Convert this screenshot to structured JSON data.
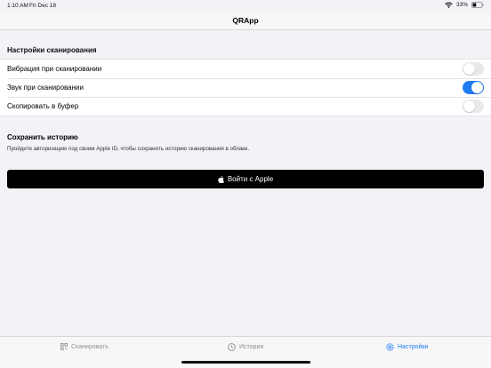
{
  "status_bar": {
    "time": "1:10 AM",
    "date": "Fri Dec 18",
    "battery": "33%",
    "icons": [
      "wifi-icon",
      "battery-icon"
    ]
  },
  "nav": {
    "title": "QRApp"
  },
  "scan_settings": {
    "header": "Настройки сканирования",
    "rows": [
      {
        "label": "Вибрация при сканировании",
        "enabled": false
      },
      {
        "label": "Звук при сканировании",
        "enabled": true
      },
      {
        "label": "Скопировать в буфер",
        "enabled": false
      }
    ]
  },
  "history": {
    "title": "Сохранить историю",
    "description": "Пройдите авторизацию под своим Apple ID, чтобы сохранить историю сканирования в облаке.",
    "button_label": "Войти с Apple",
    "button_icon": "apple-logo-icon"
  },
  "tabs": [
    {
      "label": "Сканировать",
      "icon": "qr-scan-icon",
      "active": false
    },
    {
      "label": "История",
      "icon": "clock-icon",
      "active": false
    },
    {
      "label": "Настройки",
      "icon": "gear-icon",
      "active": true
    }
  ],
  "colors": {
    "accent": "#1e7bf2",
    "background": "#f2f2f7",
    "button": "#000000"
  }
}
